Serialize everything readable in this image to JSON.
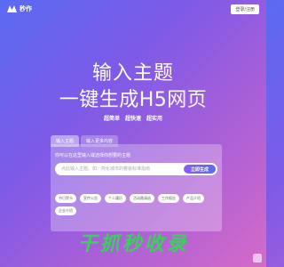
{
  "header": {
    "logo_text": "秒作",
    "login_label": "登录/注册"
  },
  "hero": {
    "title_line1": "输入主题",
    "title_line2": "一键生成H5网页",
    "features": [
      "超简单",
      "超快速",
      "超实用"
    ]
  },
  "tabs": [
    {
      "label": "输入主题",
      "active": true
    },
    {
      "label": "输入更多内容",
      "active": false
    }
  ],
  "panel": {
    "hint": "你可以在这里输入或选择你想要的主题",
    "search_placeholder": "点此输入主题。如：简化城市的着装标准指南",
    "generate_label": "立即生成",
    "chips": [
      "节日贺卡",
      "宣传公告",
      "个人履历",
      "活动邀请函",
      "工作报告",
      "产品介绍",
      "企业介绍"
    ]
  },
  "watermark": "干抓秒收录",
  "colors": {
    "bg_start": "#5a6bf2",
    "bg_end": "#d46ac8",
    "accent": "#7d5ae8",
    "watermark": "#3ccf5e"
  }
}
